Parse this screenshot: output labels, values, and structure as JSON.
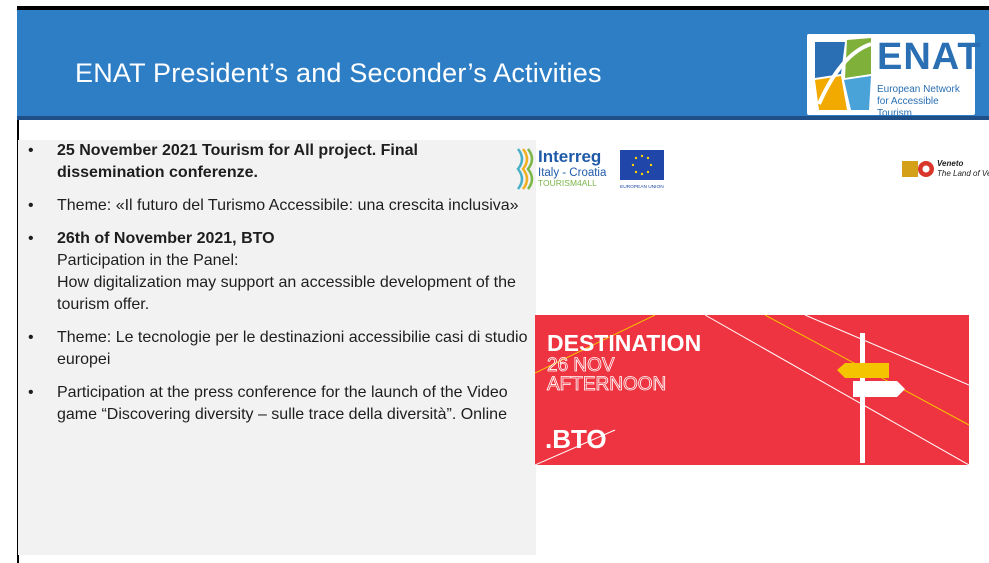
{
  "slide": {
    "title": "ENAT President’s and Seconder’s Activities"
  },
  "logo": {
    "wordmark": "ENAT",
    "subtitle": "European Network for Accessible Tourism"
  },
  "bullets": [
    {
      "marker": "•",
      "bold": "25 November 2021 Tourism for All project. Final dissemination conferenze.",
      "lines": []
    },
    {
      "marker": "•",
      "bold": "",
      "lines": [
        "Theme: «Il futuro del Turismo Accessibile: una crescita inclusiva»"
      ]
    },
    {
      "marker": "•",
      "bold": "26th of November 2021, BTO",
      "lines": [
        "Participation in the Panel:",
        "How digitalization may support an accessible development of the tourism offer."
      ]
    },
    {
      "marker": "•",
      "bold": "",
      "lines": [
        "Theme: Le tecnologie per le destinazioni accessibilie casi di studio europei"
      ]
    },
    {
      "marker": "•",
      "bold": "",
      "lines": [
        "Participation at the press conference for the launch of the Video game “Discovering diversity – sulle trace della diversità”. Online"
      ]
    }
  ],
  "interreg": {
    "brand": "Interreg",
    "region": "Italy - Croatia",
    "project": "TOURISM4ALL",
    "eu": "EUROPEAN UNION"
  },
  "veneto": {
    "name": "Veneto",
    "tagline": "The Land of Venice"
  },
  "bto_banner": {
    "line1": "DESTINATION",
    "line2": "26 NOV",
    "line3": "AFTERNOON",
    "brand": ".BTO"
  },
  "colors": {
    "header": "#2d7ec5",
    "bto_red": "#ee3440",
    "signpost_yellow": "#f5c400",
    "enat_blue": "#2a6fb3"
  }
}
